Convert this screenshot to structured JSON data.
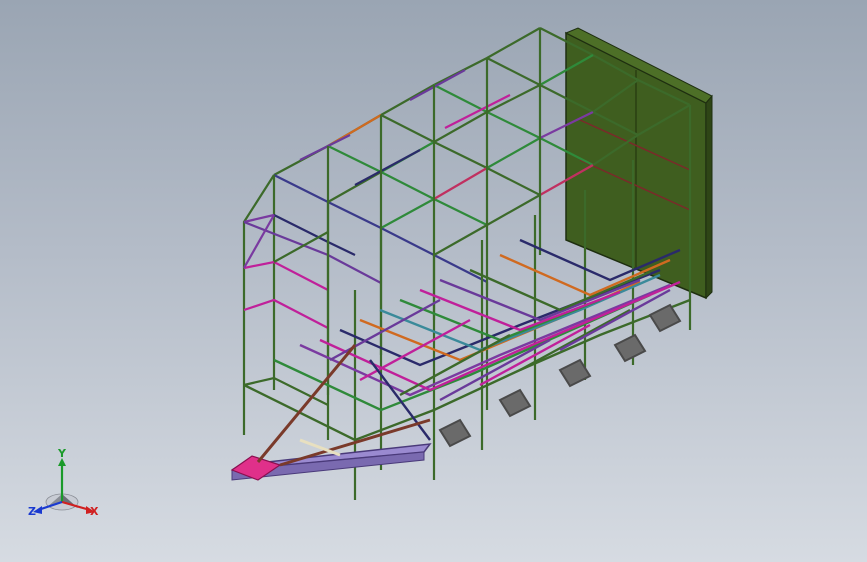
{
  "viewport": {
    "background_top": "#9aa5b3",
    "background_bottom": "#d6dbe2"
  },
  "model": {
    "description_icon": "trailer-frame-assembly",
    "colors": {
      "frame_green": "#3c6a2a",
      "frame_purple": "#6a3a9a",
      "frame_magenta": "#c0209a",
      "frame_orange": "#d06a20",
      "frame_navy": "#2a2a6a",
      "panel_green": "#3f5e1f",
      "hitch_pink": "#e0308a",
      "tongue_lavender": "#9a8ad0"
    }
  },
  "triad": {
    "x_label": "X",
    "y_label": "Y",
    "z_label": "Z",
    "x_color": "#d02020",
    "y_color": "#1a9a2a",
    "z_color": "#1a3ad0"
  }
}
